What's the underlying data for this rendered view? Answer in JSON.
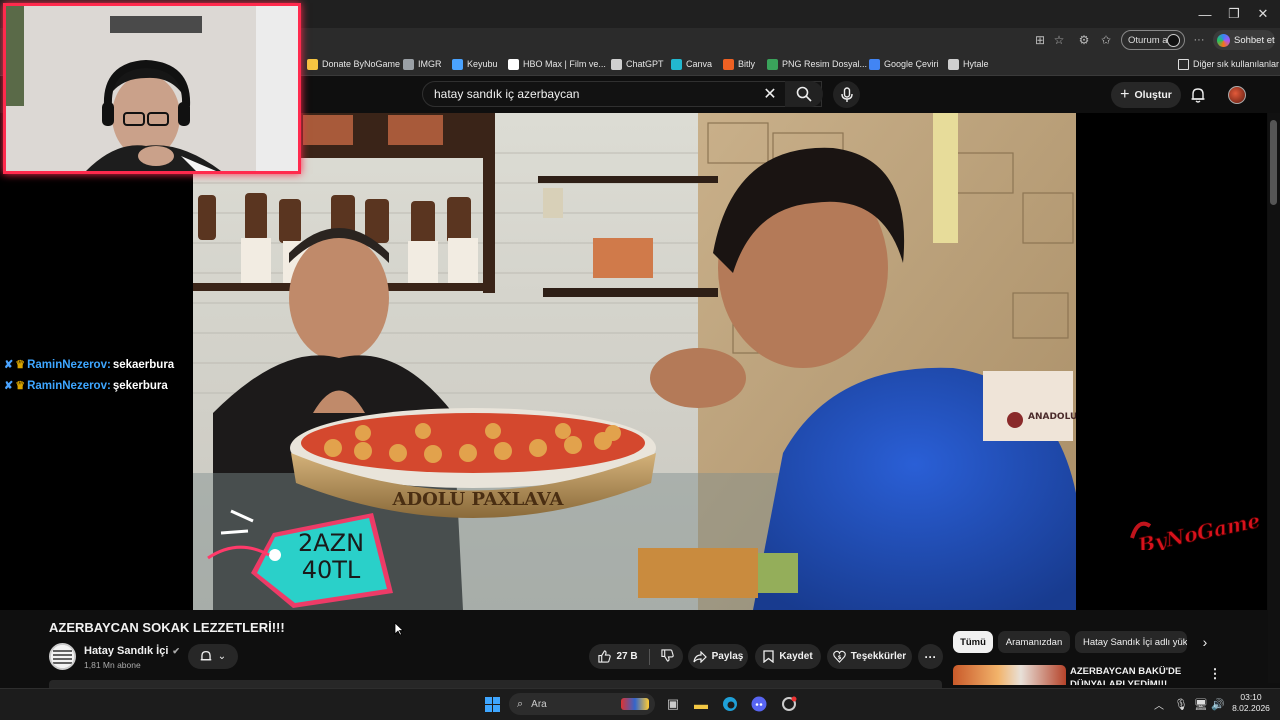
{
  "browser": {
    "signin_label": "Oturum aç",
    "copilot_label": "Sohbet et",
    "more_label": "···",
    "bookmarks": [
      {
        "label": "Donate ByNoGame",
        "color": "#f5c542"
      },
      {
        "label": "IMGR",
        "color": "#9aa0a6"
      },
      {
        "label": "Keyubu",
        "color": "#4aa3ff"
      },
      {
        "label": "HBO Max | Film ve...",
        "color": "#ffffff"
      },
      {
        "label": "ChatGPT",
        "color": "#cfcfcf"
      },
      {
        "label": "Canva",
        "color": "#22b8cf"
      },
      {
        "label": "Bitly",
        "color": "#ee6123"
      },
      {
        "label": "PNG Resim Dosyal...",
        "color": "#3aa35b"
      },
      {
        "label": "Google Çeviri",
        "color": "#4285f4"
      },
      {
        "label": "Hytale",
        "color": "#cfcfcf"
      }
    ],
    "other_bookmarks": "Diğer sık kullanılanlar"
  },
  "youtube": {
    "search_query": "hatay sandık iç azerbaycan",
    "create_label": "Oluştur",
    "video": {
      "price_line1": "2AZN",
      "price_line2": "40TL",
      "tray_text": "ADOLU PAXLAVA",
      "sign_text": "ANADOLU PAXLAVA",
      "sign_left": "ANADOLU PAXLAVA"
    },
    "title": "AZERBAYCAN SOKAK LEZZETLERİ!!!",
    "channel": {
      "name": "Hatay Sandık İçi",
      "subscribers": "1,81 Mn abone"
    },
    "actions": {
      "likes": "27 B",
      "share": "Paylaş",
      "save": "Kaydet",
      "thanks": "Teşekkürler"
    },
    "chips": [
      {
        "label": "Tümü",
        "active": true
      },
      {
        "label": "Aramanızdan",
        "active": false
      },
      {
        "label": "Hatay Sandık İçi adlı yük",
        "active": false
      }
    ],
    "recommendation": {
      "title": "AZERBAYCAN BAKÜ'DE DÜNYALARI YEDİM!!!"
    }
  },
  "stream": {
    "chat": [
      {
        "user": "RaminNezerov:",
        "message": "sekaerbura"
      },
      {
        "user": "RaminNezerov:",
        "message": "şekerbura"
      }
    ],
    "watermark": "ByNoGame"
  },
  "taskbar": {
    "search_label": "Ara",
    "time": "03:10",
    "date": "8.02.2026"
  }
}
